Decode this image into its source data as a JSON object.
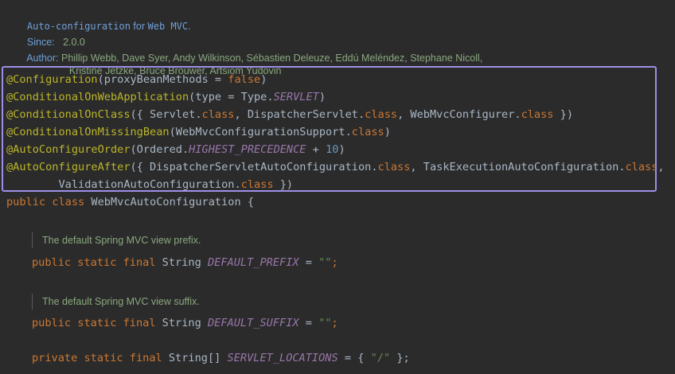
{
  "doc": {
    "summary_link": "Auto-configuration",
    "summary_rest": " for ",
    "summary_link2": "Web MVC",
    "summary_end": ".",
    "since_label": "Since:",
    "since_value": "2.0.0",
    "author_label": "Author:",
    "authors_line1": "Phillip Webb, Dave Syer, Andy Wilkinson, Sébastien Deleuze, Eddú Meléndez, Stephane Nicoll,",
    "authors_line2": "Kristine Jetzke, Bruce Brouwer, Artsiom Yudovin"
  },
  "annotations": {
    "configuration": "@Configuration",
    "configuration_args_open": "(proxyBeanMethods = ",
    "configuration_false": "false",
    "configuration_close": ")",
    "on_web_app": "@ConditionalOnWebApplication",
    "on_web_app_args": "(type = Type.",
    "on_web_app_servlet": "SERVLET",
    "on_web_app_close": ")",
    "on_class": "@ConditionalOnClass",
    "on_class_open": "({ Servlet.",
    "class_kw": "class",
    "on_class_mid1": ", DispatcherServlet.",
    "on_class_mid2": ", WebMvcConfigurer.",
    "on_class_close": " })",
    "on_missing_bean": "@ConditionalOnMissingBean",
    "on_missing_bean_args": "(WebMvcConfigurationSupport.",
    "on_missing_bean_close": ")",
    "order": "@AutoConfigureOrder",
    "order_args": "(Ordered.",
    "order_const": "HIGHEST_PRECEDENCE",
    "order_plus": " + ",
    "order_num": "10",
    "order_close": ")",
    "after": "@AutoConfigureAfter",
    "after_open": "({ DispatcherServletAutoConfiguration.",
    "after_mid": ", TaskExecutionAutoConfiguration.",
    "after_comma": ",",
    "after_line2_start": "        ValidationAutoConfiguration.",
    "after_close": " })"
  },
  "class_decl": {
    "public": "public",
    "class_kw": "class",
    "name": " WebMvcAutoConfiguration {"
  },
  "fields": [
    {
      "doc": "The default Spring MVC view prefix.",
      "modifiers": "public static final",
      "type": " String ",
      "name": "DEFAULT_PREFIX",
      "assign": " = ",
      "value": "\"\"",
      "end": ";"
    },
    {
      "doc": "The default Spring MVC view suffix.",
      "modifiers": "public static final",
      "type": " String ",
      "name": "DEFAULT_SUFFIX",
      "assign": " = ",
      "value": "\"\"",
      "end": ";"
    },
    {
      "modifiers": "private static final",
      "type": " String[] ",
      "name": "SERVLET_LOCATIONS",
      "assign": " = { ",
      "value": "\"/\"",
      "end": " };"
    }
  ],
  "colors": {
    "background": "#2b2b2b",
    "annotation": "#bbb529",
    "keyword": "#cc7832",
    "constant": "#9876aa",
    "number": "#6897bb",
    "string": "#6a8759",
    "highlight_border": "#9d8fe8"
  }
}
